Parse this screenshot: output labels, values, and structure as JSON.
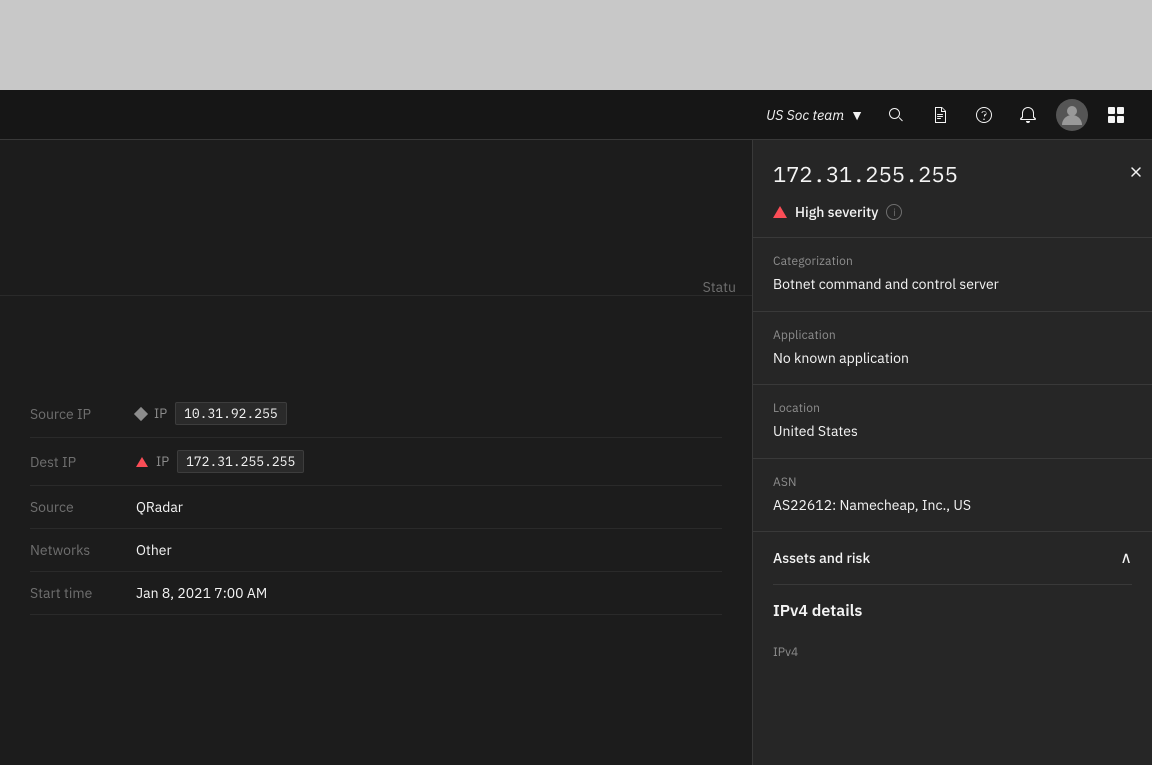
{
  "browser_chrome": {
    "height": 90
  },
  "header": {
    "team_name": "US Soc team",
    "team_dropdown_icon": "chevron-down",
    "search_icon": "search",
    "report_icon": "document",
    "help_icon": "question-mark",
    "notification_icon": "bell",
    "avatar_icon": "user-avatar",
    "apps_icon": "grid"
  },
  "left_panel": {
    "status_label": "Statu",
    "rows": [
      {
        "label": "Source IP",
        "ip_type_icon": "diamond",
        "ip_label": "IP",
        "ip_value": "10.31.92.255"
      },
      {
        "label": "Dest IP",
        "ip_type_icon": "triangle-up",
        "ip_label": "IP",
        "ip_value": "172.31.255.255"
      },
      {
        "label": "Source",
        "value": "QRadar"
      },
      {
        "label": "Networks",
        "value": "Other"
      },
      {
        "label": "Start time",
        "value": "Jan 8, 2021 7:00 AM"
      }
    ]
  },
  "right_panel": {
    "ip_address": "172.31.255.255",
    "close_icon": "close",
    "severity": {
      "icon": "triangle-warning",
      "label": "High severity",
      "info_icon": "info"
    },
    "categorization": {
      "label": "Categorization",
      "value": "Botnet command and control server"
    },
    "application": {
      "label": "Application",
      "value": "No known  application"
    },
    "location": {
      "label": "Location",
      "value": "United States"
    },
    "asn": {
      "label": "ASN",
      "value": "AS22612: Namecheap, Inc., US"
    },
    "assets_section": {
      "label": "Assets and risk",
      "chevron_icon": "chevron-up"
    },
    "ipv4_details": {
      "title": "IPv4 details",
      "label": "IPv4"
    }
  },
  "colors": {
    "background_dark": "#161616",
    "panel_bg": "#262626",
    "text_primary": "#f4f4f4",
    "text_secondary": "#8d8d8d",
    "text_dim": "#6f6f6f",
    "red": "#fa4d56",
    "border": "#393939"
  }
}
